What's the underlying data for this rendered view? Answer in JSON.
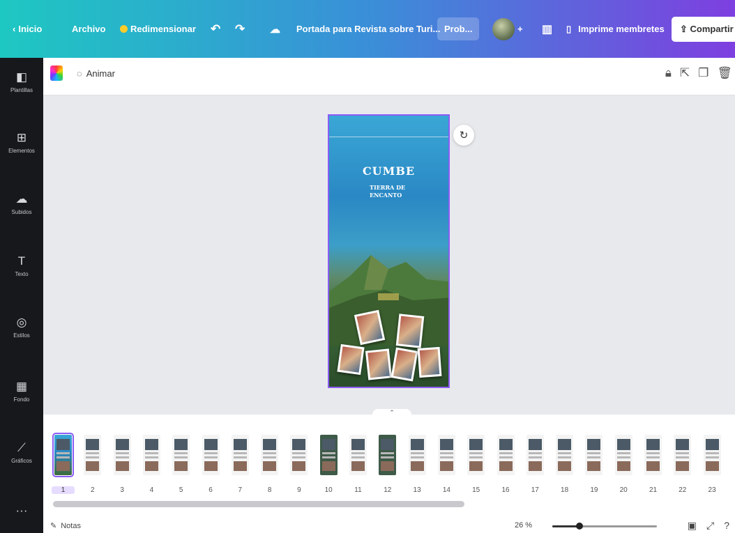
{
  "topbar": {
    "home": "Inicio",
    "file": "Archivo",
    "resize": "Redimensionar",
    "undo_icon": "undo-icon",
    "redo_icon": "redo-icon",
    "cloud_icon": "cloud-check-icon",
    "doc_title": "Portada para Revista sobre Turi...",
    "pro_pill": "Prob...",
    "add_member": "+",
    "chart_icon": "bar-chart-icon",
    "print_label": "Imprime membretes",
    "share_label": "Compartir"
  },
  "sidebar": {
    "items": [
      {
        "label": "Plantillas",
        "icon": "templates-icon"
      },
      {
        "label": "Elementos",
        "icon": "elements-icon"
      },
      {
        "label": "Subidos",
        "icon": "upload-icon"
      },
      {
        "label": "Texto",
        "icon": "text-icon"
      },
      {
        "label": "Estilos",
        "icon": "styles-icon"
      },
      {
        "label": "Fondo",
        "icon": "background-icon"
      },
      {
        "label": "Gráficos",
        "icon": "charts-icon"
      },
      {
        "label": "···",
        "icon": "more-icon"
      }
    ]
  },
  "toolbar": {
    "animate": "Animar"
  },
  "page": {
    "title": "CUMBE",
    "subtitle_line1": "TIERRA DE",
    "subtitle_line2": "ENCANTO"
  },
  "filmstrip": {
    "pages": [
      "1",
      "2",
      "3",
      "4",
      "5",
      "6",
      "7",
      "8",
      "9",
      "10",
      "11",
      "12",
      "13",
      "14",
      "15",
      "16",
      "17",
      "18",
      "19",
      "20",
      "21",
      "22",
      "23"
    ],
    "selected_index": 0
  },
  "statusbar": {
    "notes": "Notas",
    "zoom": "26 %",
    "zoom_level": 0.26
  },
  "colors": {
    "accent": "#8b5cf6",
    "sidebar_bg": "#17181c",
    "topbar_start": "#1ec8c2",
    "topbar_end": "#7e3fe0"
  }
}
